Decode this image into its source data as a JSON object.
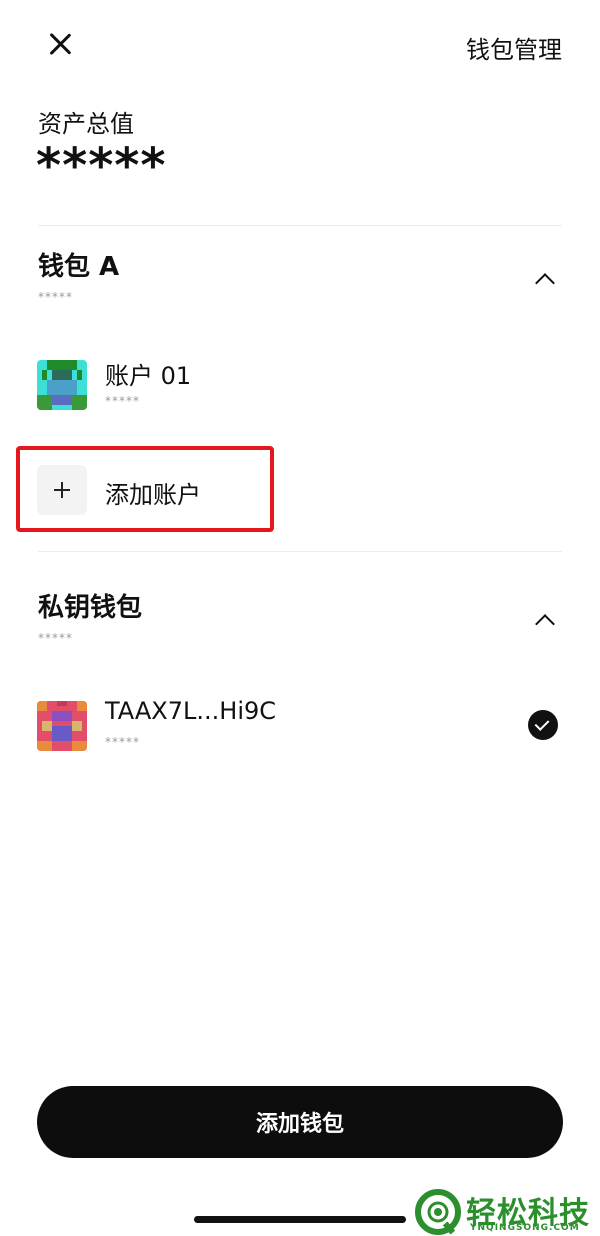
{
  "header": {
    "manage_label": "钱包管理"
  },
  "total": {
    "label": "资产总值",
    "value": "*****"
  },
  "wallets": [
    {
      "title": "钱包 A",
      "subtitle": "*****",
      "accounts": [
        {
          "name": "账户 01",
          "subtitle": "*****",
          "selected": false
        }
      ],
      "add_account_label": "添加账户"
    },
    {
      "title": "私钥钱包",
      "subtitle": "*****",
      "accounts": [
        {
          "name": "TAAX7L...Hi9C",
          "subtitle": "*****",
          "selected": true
        }
      ]
    }
  ],
  "add_wallet_label": "添加钱包",
  "watermark": {
    "title": "轻松科技",
    "subtitle": "YNQINGSONG.COM"
  },
  "colors": {
    "highlight": "#e4171e",
    "primary": "#0d0d0d",
    "watermark": "#2c8f2e"
  },
  "icons": {
    "close": "close-icon",
    "collapse": "chevron-up-icon",
    "add": "plus-icon",
    "selected": "check-circle-icon"
  }
}
